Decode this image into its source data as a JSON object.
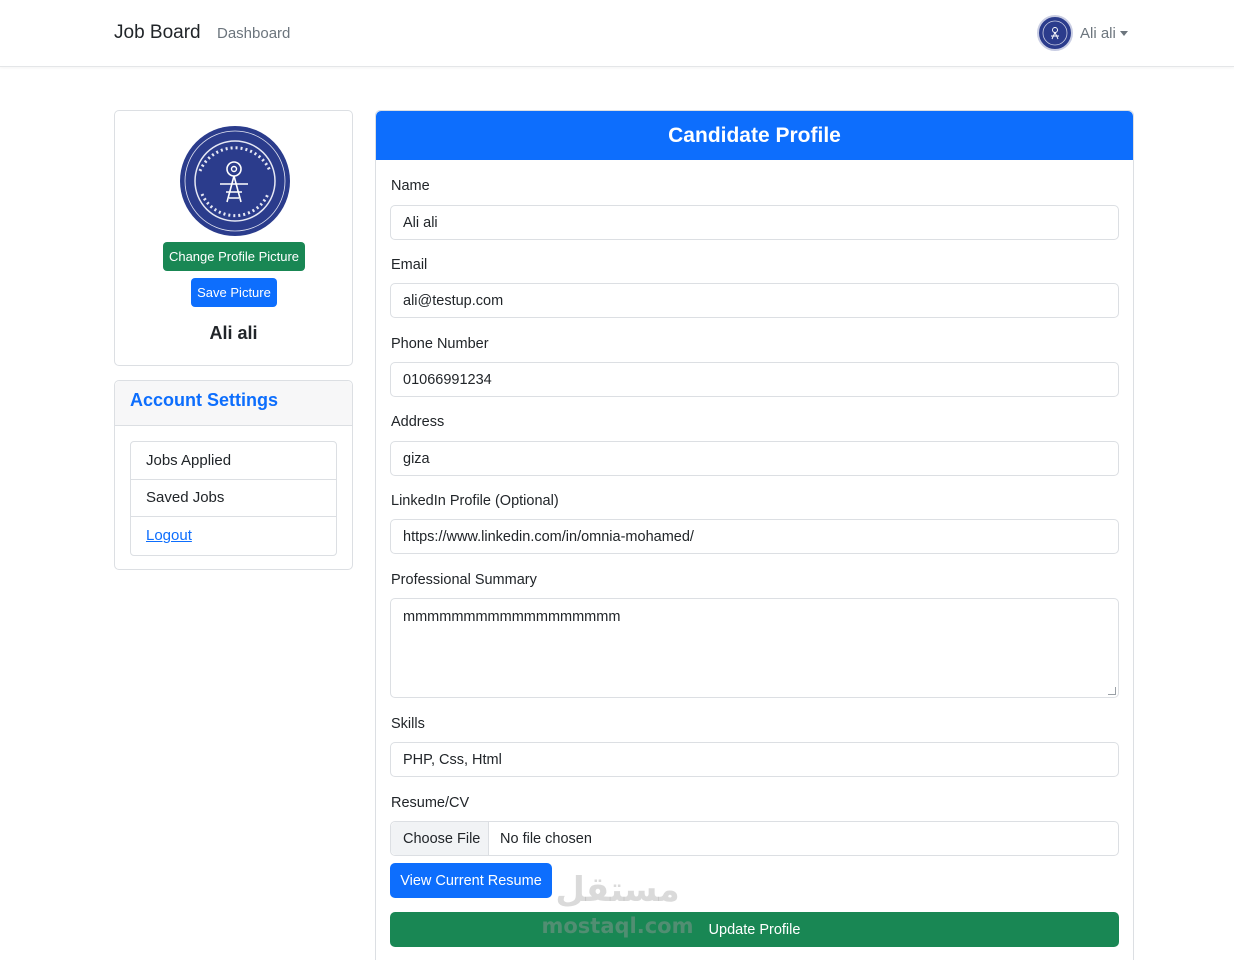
{
  "navbar": {
    "brand": "Job Board",
    "dashboard_link": "Dashboard",
    "user_name": "Ali ali"
  },
  "profile": {
    "change_picture_label": "Change Profile Picture",
    "save_picture_label": "Save Picture",
    "name": "Ali ali"
  },
  "account_settings": {
    "title": "Account Settings",
    "items": [
      {
        "label": "Jobs Applied"
      },
      {
        "label": "Saved Jobs"
      },
      {
        "label": "Logout"
      }
    ]
  },
  "form": {
    "title": "Candidate Profile",
    "name_label": "Name",
    "name_value": "Ali ali",
    "email_label": "Email",
    "email_value": "ali@testup.com",
    "phone_label": "Phone Number",
    "phone_value": "01066991234",
    "address_label": "Address",
    "address_value": "giza",
    "linkedin_label": "LinkedIn Profile (Optional)",
    "linkedin_value": "https://www.linkedin.com/in/omnia-mohamed/",
    "summary_label": "Professional Summary",
    "summary_value": "mmmmmmmmmmmmmmmmmm",
    "skills_label": "Skills",
    "skills_value": "PHP, Css, Html",
    "resume_label": "Resume/CV",
    "choose_file_label": "Choose File",
    "file_status": "No file chosen",
    "view_resume_label": "View Current Resume",
    "update_label": "Update Profile"
  },
  "watermark": {
    "arabic": "مستقل",
    "latin": "mostaql.com"
  },
  "colors": {
    "primary": "#0d6efd",
    "success": "#198754",
    "logo_blue": "#2b3c8c"
  }
}
